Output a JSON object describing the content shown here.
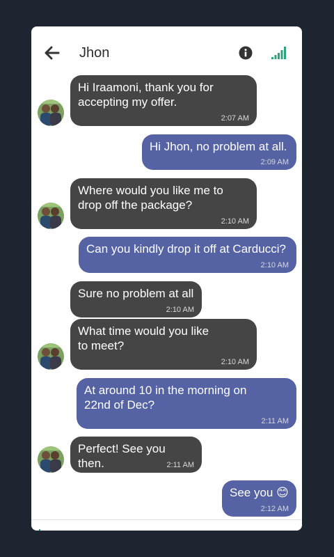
{
  "header": {
    "contact_name": "Jhon",
    "back_icon": "arrow-left-icon",
    "info_icon": "info-icon",
    "signal_icon": "signal-bars-icon",
    "signal_color": "#2ca37a"
  },
  "colors": {
    "background": "#1f2431",
    "incoming_bubble": "#454545",
    "outgoing_bubble": "#5562a3"
  },
  "messages": [
    {
      "direction": "incoming",
      "text": "Hi Iraamoni, thank you for\naccepting my offer.",
      "time": "2:07 AM",
      "avatar": true
    },
    {
      "direction": "outgoing",
      "text": "Hi Jhon, no problem at all.",
      "time": "2:09 AM"
    },
    {
      "direction": "incoming",
      "text": "Where would you like me to\ndrop off the package?",
      "time": "2:10 AM",
      "avatar": true
    },
    {
      "direction": "outgoing",
      "text": "Can you kindly drop it off at Carducci?",
      "time": "2:10 AM"
    },
    {
      "direction": "incoming",
      "text": "Sure no problem at all",
      "time": "2:10 AM",
      "avatar": false
    },
    {
      "direction": "incoming",
      "text": "What time would you like\nto meet?",
      "time": "2:10 AM",
      "avatar": true
    },
    {
      "direction": "outgoing",
      "text": "At around 10 in the morning on\n22nd of Dec?",
      "time": "2:11 AM"
    },
    {
      "direction": "incoming",
      "text": "Perfect! See you then.",
      "time": "2:11 AM",
      "avatar": true
    },
    {
      "direction": "outgoing",
      "text": "See you 😊",
      "time": "2:12 AM"
    }
  ]
}
